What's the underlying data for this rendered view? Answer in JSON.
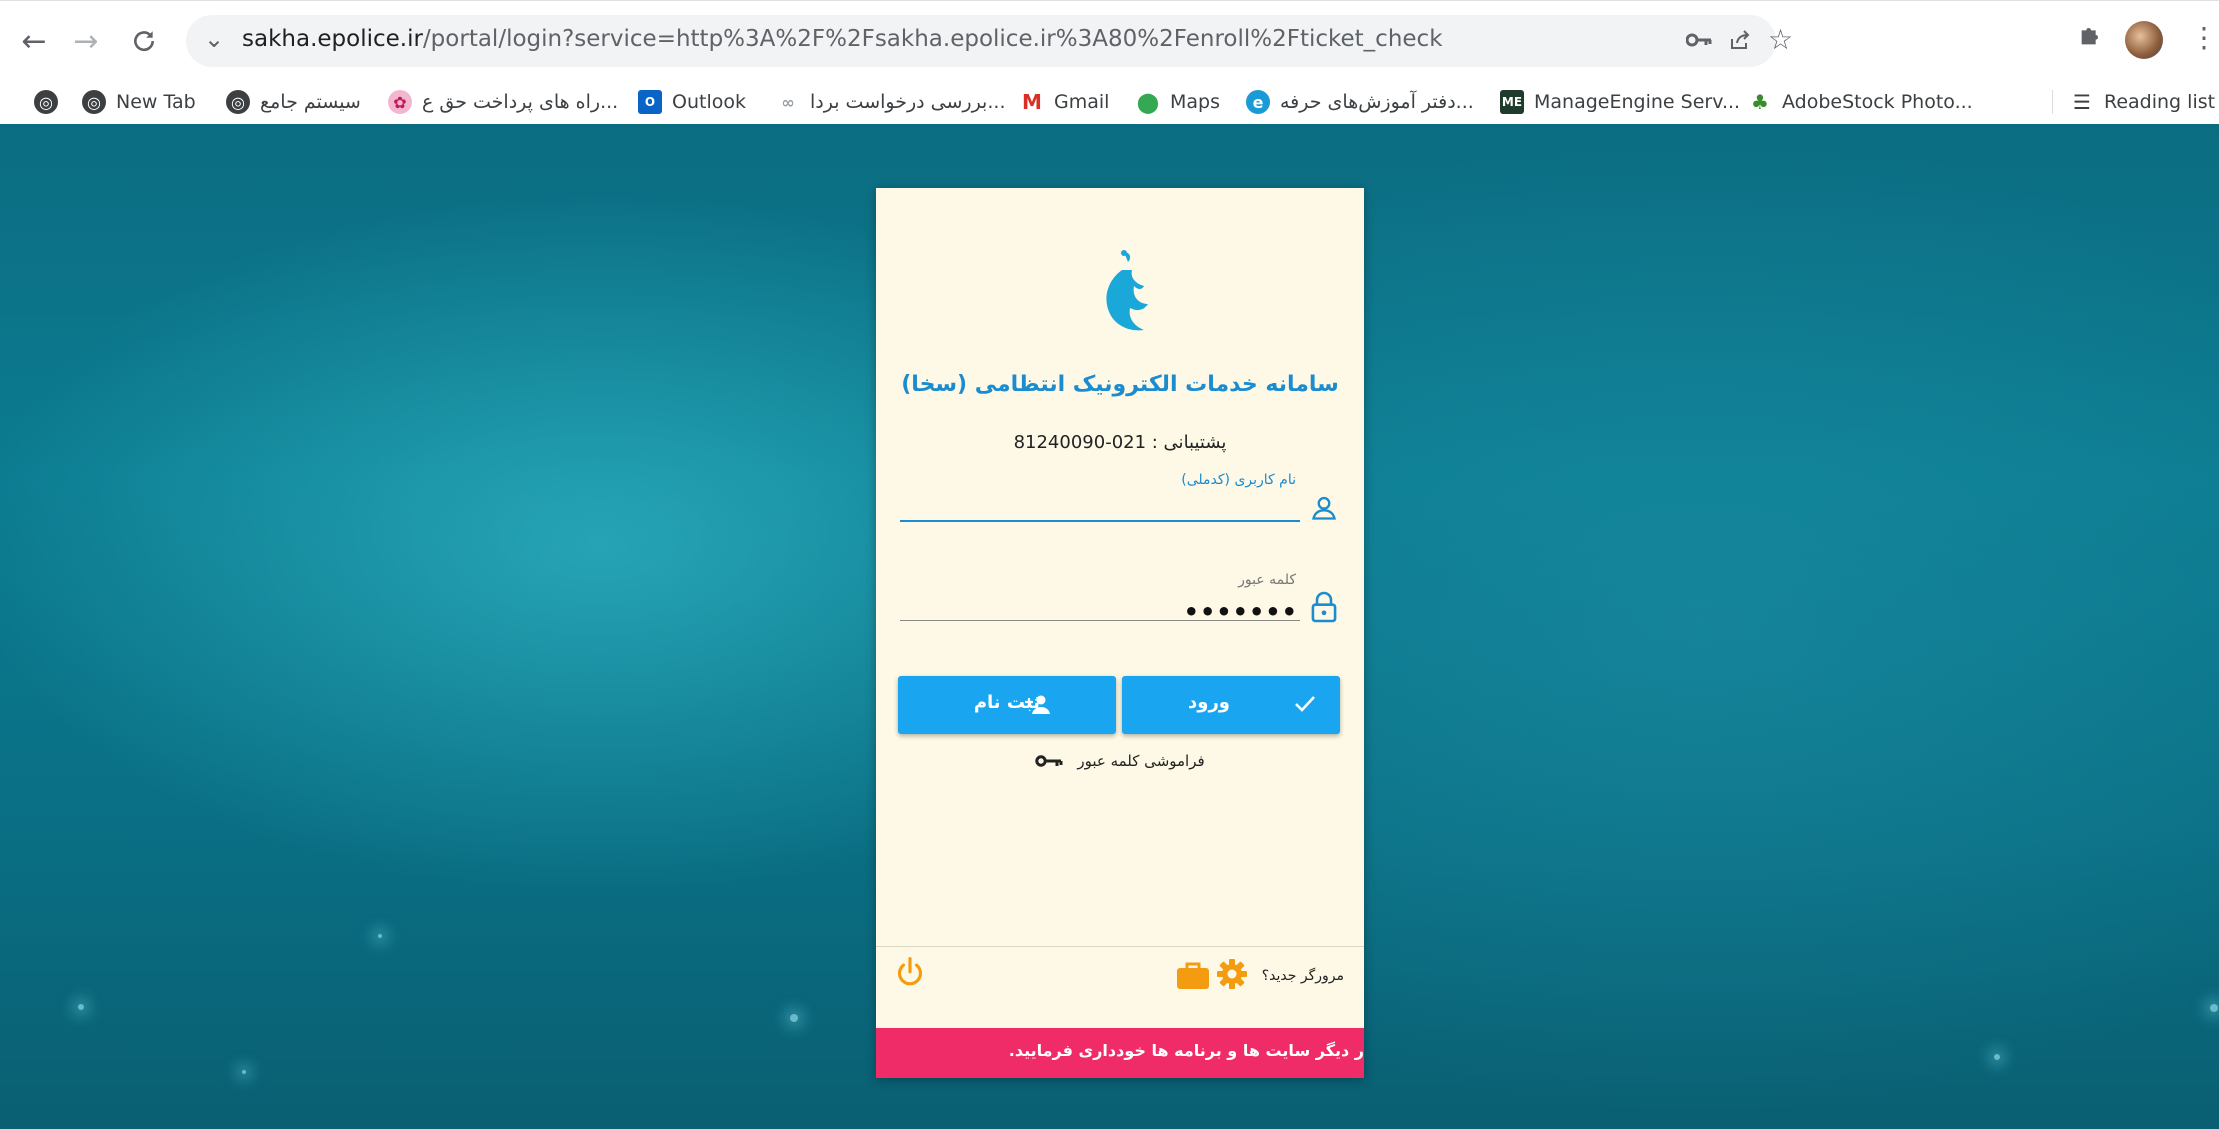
{
  "browser": {
    "url_host": "sakha.epolice.ir",
    "url_rest": "/portal/login?service=http%3A%2F%2Fsakha.epolice.ir%3A80%2Fenroll%2Fticket_check",
    "bookmarks": [
      {
        "label": "",
        "icon": "globe-icon"
      },
      {
        "label": "New Tab",
        "icon": "globe-icon"
      },
      {
        "label": "سیستم جامع",
        "icon": "globe-icon"
      },
      {
        "label": "راه های پرداخت حق ع...",
        "icon": "flower-icon"
      },
      {
        "label": "Outlook",
        "icon": "outlook-icon"
      },
      {
        "label": "بررسی درخواست بردا...",
        "icon": "link-icon"
      },
      {
        "label": "Gmail",
        "icon": "gmail-icon"
      },
      {
        "label": "Maps",
        "icon": "maps-icon"
      },
      {
        "label": "دفتر آموزش‌های حرفه...",
        "icon": "circle-icon"
      },
      {
        "label": "ManageEngine Serv...",
        "icon": "manageengine-icon"
      },
      {
        "label": "AdobeStock Photo...",
        "icon": "adobe-icon"
      }
    ],
    "reading_list": "Reading list"
  },
  "login": {
    "title": "سامانه خدمات الکترونیک انتظامی (سخا)",
    "support": "پشتیبانی : 021-81240090",
    "username_label": "نام کاربری (کدملی)",
    "password_label": "کلمه عبور",
    "password_value": "•••••••",
    "login_button": "ورود",
    "register_button": "ثبت نام",
    "forgot_password": "فراموشی کلمه عبور",
    "new_browser": "مرورگر جدید؟",
    "warning_marquee": "ر دیگر سایت ها و برنامه ها خودداری فرمایید."
  },
  "colors": {
    "accent_blue": "#1aa5f0",
    "title_blue": "#1a8ccf",
    "warning_pink": "#ef2b68",
    "icon_orange": "#f39c12"
  }
}
